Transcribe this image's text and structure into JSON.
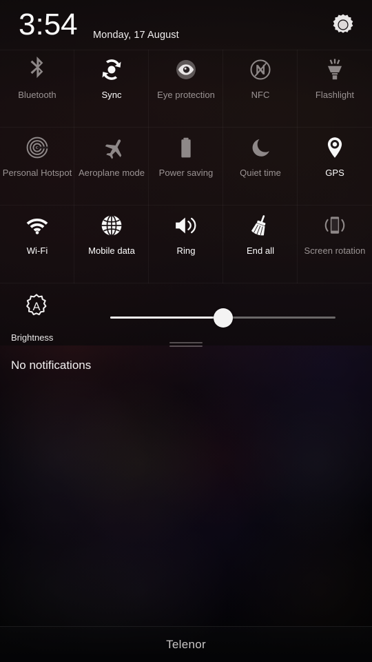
{
  "status": {
    "time": "3:54",
    "date": "Monday, 17 August",
    "settings_icon": "gear-icon"
  },
  "quick_settings": {
    "rows": [
      [
        {
          "label": "Bluetooth",
          "icon": "bluetooth-icon",
          "state": "off"
        },
        {
          "label": "Sync",
          "icon": "sync-icon",
          "state": "on"
        },
        {
          "label": "Eye protection",
          "icon": "eye-icon",
          "state": "off"
        },
        {
          "label": "NFC",
          "icon": "nfc-icon",
          "state": "off"
        },
        {
          "label": "Flashlight",
          "icon": "flashlight-icon",
          "state": "off"
        }
      ],
      [
        {
          "label": "Personal Hotspot",
          "icon": "hotspot-icon",
          "state": "off"
        },
        {
          "label": "Aeroplane mode",
          "icon": "airplane-icon",
          "state": "off"
        },
        {
          "label": "Power saving",
          "icon": "battery-icon",
          "state": "off"
        },
        {
          "label": "Quiet time",
          "icon": "moon-icon",
          "state": "off"
        },
        {
          "label": "GPS",
          "icon": "location-pin-icon",
          "state": "on"
        }
      ],
      [
        {
          "label": "Wi-Fi",
          "icon": "wifi-icon",
          "state": "on"
        },
        {
          "label": "Mobile data",
          "icon": "globe-icon",
          "state": "on"
        },
        {
          "label": "Ring",
          "icon": "speaker-icon",
          "state": "on"
        },
        {
          "label": "End all",
          "icon": "broom-icon",
          "state": "on"
        },
        {
          "label": "Screen rotation",
          "icon": "screen-rotation-icon",
          "state": "off"
        }
      ]
    ]
  },
  "brightness": {
    "label": "Brightness",
    "auto_icon": "auto-brightness-icon",
    "value_percent": 50
  },
  "notifications": {
    "empty_text": "No notifications"
  },
  "footer": {
    "carrier": "Telenor"
  },
  "colors": {
    "text_on": "#ffffff",
    "text_off": "#9b9494",
    "slider_fill": "#f6f5f5",
    "slider_track": "#6a6868",
    "carrier_text": "#c9c6c6"
  }
}
